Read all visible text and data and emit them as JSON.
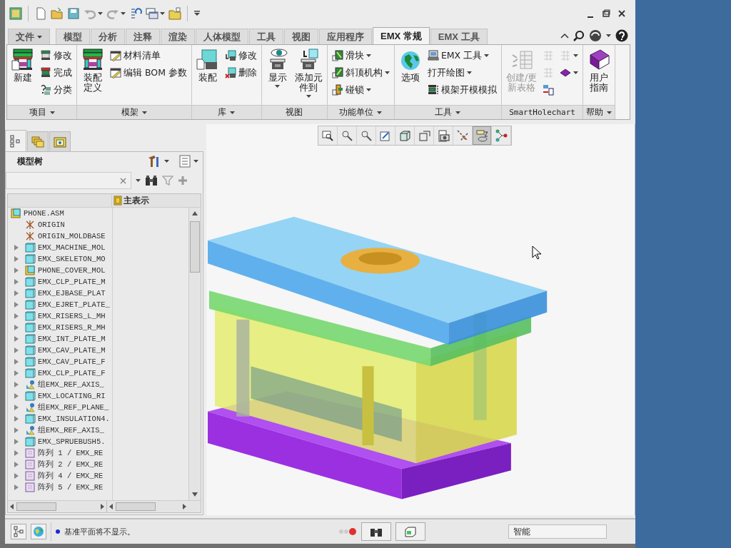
{
  "ribbon": {
    "tabs": [
      {
        "label": "文件",
        "kind": "menu",
        "selected": false
      },
      {
        "label": "模型",
        "kind": "tab",
        "selected": false
      },
      {
        "label": "分析",
        "kind": "tab",
        "selected": false
      },
      {
        "label": "注释",
        "kind": "tab",
        "selected": false
      },
      {
        "label": "渲染",
        "kind": "tab",
        "selected": false
      },
      {
        "label": "人体模型",
        "kind": "tab",
        "selected": false
      },
      {
        "label": "工具",
        "kind": "tab",
        "selected": false
      },
      {
        "label": "视图",
        "kind": "tab",
        "selected": false
      },
      {
        "label": "应用程序",
        "kind": "tab",
        "selected": false
      },
      {
        "label": "EMX 常规",
        "kind": "tab",
        "selected": true
      },
      {
        "label": "EMX 工具",
        "kind": "tab",
        "selected": false
      }
    ],
    "groups": [
      {
        "title": "项目",
        "dropdown": true,
        "columns": [
          {
            "kind": "large",
            "label": [
              "新建"
            ],
            "dropdown": false,
            "disabled": false
          },
          {
            "kind": "stack",
            "items": [
              {
                "label": "修改",
                "dropdown": false,
                "disabled": false
              },
              {
                "label": "完成",
                "dropdown": false,
                "disabled": false
              },
              {
                "label": "分类",
                "dropdown": false,
                "disabled": false
              }
            ]
          }
        ]
      },
      {
        "title": "模架",
        "dropdown": true,
        "columns": [
          {
            "kind": "large",
            "label": [
              "装配",
              "定义"
            ],
            "dropdown": false,
            "disabled": false
          },
          {
            "kind": "stack",
            "items": [
              {
                "label": "材料清单",
                "dropdown": false,
                "disabled": false
              },
              {
                "label": "编辑 BOM 参数",
                "dropdown": false,
                "disabled": false
              }
            ]
          }
        ]
      },
      {
        "title": "库",
        "dropdown": true,
        "columns": [
          {
            "kind": "large",
            "label": [
              "装配"
            ],
            "dropdown": false,
            "disabled": false
          },
          {
            "kind": "stack",
            "items": [
              {
                "label": "修改",
                "dropdown": false,
                "disabled": false
              },
              {
                "label": "删除",
                "dropdown": false,
                "disabled": false
              }
            ]
          }
        ]
      },
      {
        "title": "视图",
        "dropdown": false,
        "columns": [
          {
            "kind": "large",
            "label": [
              "显示"
            ],
            "dropdown": true,
            "disabled": false
          },
          {
            "kind": "large",
            "label": [
              "添加元",
              "件到"
            ],
            "dropdown": true,
            "disabled": false
          }
        ]
      },
      {
        "title": "功能单位",
        "dropdown": true,
        "columns": [
          {
            "kind": "stack",
            "items": [
              {
                "label": "滑块",
                "dropdown": true,
                "disabled": false
              },
              {
                "label": "斜顶机构",
                "dropdown": true,
                "disabled": false
              },
              {
                "label": "碰锁",
                "dropdown": true,
                "disabled": false
              }
            ]
          }
        ]
      },
      {
        "title": "工具",
        "dropdown": true,
        "columns": [
          {
            "kind": "large",
            "label": [
              "选项"
            ],
            "dropdown": false,
            "disabled": false
          },
          {
            "kind": "stack",
            "items": [
              {
                "label": "EMX 工具",
                "dropdown": true,
                "disabled": false
              },
              {
                "label": "打开绘图",
                "dropdown": true,
                "disabled": false
              },
              {
                "label": "模架开模模拟",
                "dropdown": false,
                "disabled": false
              }
            ]
          }
        ]
      },
      {
        "title": "SmartHolechart",
        "dropdown": false,
        "columns": [
          {
            "kind": "large",
            "label": [
              "创建/更",
              "新表格"
            ],
            "dropdown": false,
            "disabled": true
          },
          {
            "kind": "stack",
            "items": [
              {
                "dropdown": false,
                "disabled": true
              },
              {
                "dropdown": false,
                "disabled": true
              },
              {
                "dropdown": false,
                "disabled": false
              }
            ]
          },
          {
            "kind": "stack",
            "items": [
              {
                "dropdown": true,
                "disabled": true
              },
              {
                "dropdown": true,
                "disabled": false
              }
            ]
          }
        ]
      },
      {
        "title": "帮助",
        "dropdown": true,
        "columns": [
          {
            "kind": "large",
            "label": [
              "用户",
              "指南"
            ],
            "dropdown": false,
            "disabled": false
          }
        ]
      }
    ]
  },
  "navigator": {
    "tabs": [
      {
        "selected": true
      },
      {
        "selected": false
      },
      {
        "selected": false
      }
    ],
    "title": "模型树",
    "column_header": "主表示",
    "items": [
      {
        "label": "PHONE.ASM",
        "kind": "assembly",
        "children": [
          {
            "label": "ORIGIN",
            "kind": "csys"
          },
          {
            "label": "ORIGIN_MOLDBASE",
            "kind": "csys"
          },
          {
            "label": "EMX_MACHINE_MOL",
            "kind": "part",
            "expanded": false
          },
          {
            "label": "EMX_SKELETON_MO",
            "kind": "part",
            "expanded": false
          },
          {
            "label": "PHONE_COVER_MOL",
            "kind": "assembly",
            "expanded": false
          },
          {
            "label": "EMX_CLP_PLATE_M",
            "kind": "part",
            "expanded": false
          },
          {
            "label": "EMX_EJBASE_PLAT",
            "kind": "part",
            "expanded": false
          },
          {
            "label": "EMX_EJRET_PLATE_",
            "kind": "part",
            "expanded": false
          },
          {
            "label": "EMX_RISERS_L_MH",
            "kind": "part",
            "expanded": false
          },
          {
            "label": "EMX_RISERS_R_MH",
            "kind": "part",
            "expanded": false
          },
          {
            "label": "EMX_INT_PLATE_M",
            "kind": "part",
            "expanded": false
          },
          {
            "label": "EMX_CAV_PLATE_M",
            "kind": "part",
            "expanded": false
          },
          {
            "label": "EMX_CAV_PLATE_F",
            "kind": "part",
            "expanded": false
          },
          {
            "label": "EMX_CLP_PLATE_F",
            "kind": "part",
            "expanded": false
          },
          {
            "label": "组EMX_REF_AXIS_",
            "kind": "group",
            "expanded": false
          },
          {
            "label": "EMX_LOCATING_RI",
            "kind": "part",
            "expanded": false
          },
          {
            "label": "组EMX_REF_PLANE_",
            "kind": "group",
            "expanded": false
          },
          {
            "label": "EMX_INSULATION4.",
            "kind": "part",
            "expanded": false
          },
          {
            "label": "组EMX_REF_AXIS_",
            "kind": "group",
            "expanded": false
          },
          {
            "label": "EMX_SPRUEBUSH5.",
            "kind": "part",
            "expanded": false
          },
          {
            "label": "阵列 1 / EMX_RE",
            "kind": "pattern",
            "expanded": false
          },
          {
            "label": "阵列 2 / EMX_RE",
            "kind": "pattern",
            "expanded": false
          },
          {
            "label": "阵列 4 / EMX_RE",
            "kind": "pattern",
            "expanded": false
          },
          {
            "label": "阵列 5 / EMX_RE",
            "kind": "pattern",
            "expanded": false
          }
        ]
      }
    ]
  },
  "view_toolbar": [
    {
      "selected": false
    },
    {
      "selected": false
    },
    {
      "selected": false
    },
    {
      "selected": false
    },
    {
      "selected": false
    },
    {
      "selected": false
    },
    {
      "selected": false
    },
    {
      "selected": false
    },
    {
      "selected": true
    },
    {
      "selected": false
    }
  ],
  "status_bar": {
    "message": "基准平面将不显示。",
    "selection_filter": "智能"
  }
}
